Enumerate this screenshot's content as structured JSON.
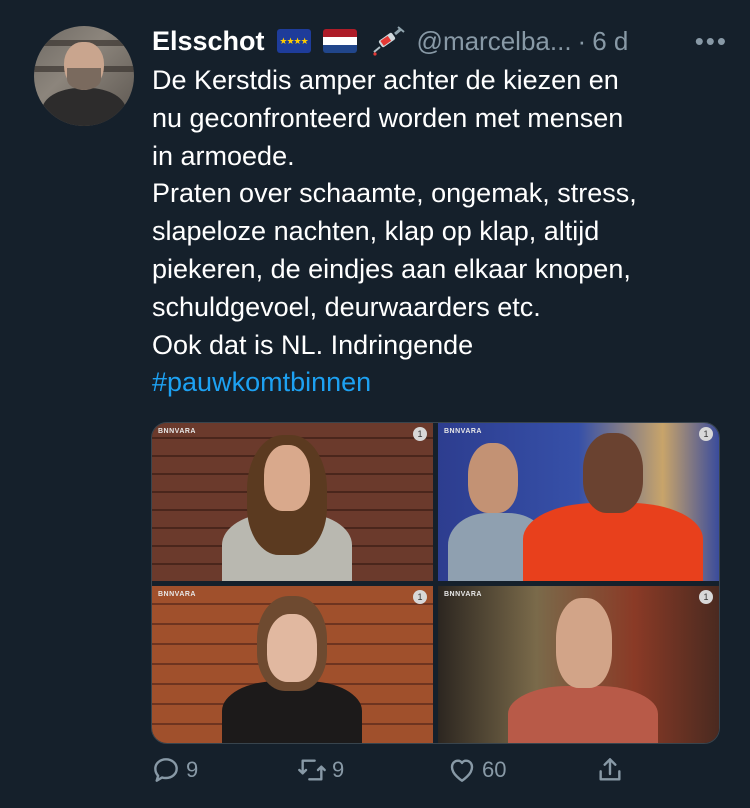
{
  "tweet": {
    "author_name": "Elsschot",
    "handle": "@marcelba...",
    "separator": "·",
    "time": "6 d",
    "more_label": "•••",
    "text_lines": [
      "De Kerstdis amper achter de kiezen en",
      "nu geconfronteerd worden met mensen",
      "in armoede.",
      "Praten over schaamte, ongemak, stress,",
      "slapeloze nachten, klap op klap, altijd",
      "piekeren, de eindjes aan elkaar knopen,",
      "schuldgevoel, deurwaarders etc.",
      "Ook dat is NL. Indringende"
    ],
    "hashtag": "#pauwkomtbinnen",
    "icons": {
      "flag1": "eu-flag-icon",
      "flag2": "netherlands-flag-icon",
      "emoji": "syringe-icon"
    }
  },
  "media": {
    "photos": [
      {
        "logo": "BNNVARA",
        "bug": "1"
      },
      {
        "logo": "BNNVARA",
        "bug": "1"
      },
      {
        "logo": "BNNVARA",
        "bug": "1"
      },
      {
        "logo": "BNNVARA",
        "bug": "1"
      }
    ]
  },
  "actions": {
    "reply_count": "9",
    "retweet_count": "9",
    "like_count": "60"
  },
  "colors": {
    "background": "#15202b",
    "secondary_text": "#8899a6",
    "link": "#1da1f2"
  }
}
